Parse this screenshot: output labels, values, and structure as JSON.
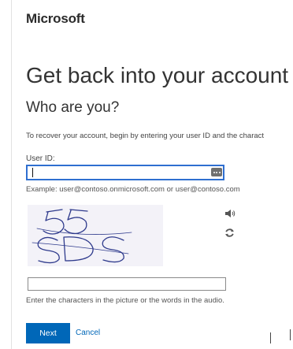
{
  "brand": {
    "name": "Microsoft"
  },
  "page": {
    "title": "Get back into your account",
    "subtitle": "Who are you?",
    "intro": "To recover your account, begin by entering your user ID and the charact"
  },
  "user_id": {
    "label": "User ID:",
    "value": "",
    "example": "Example: user@contoso.onmicrosoft.com or user@contoso.com"
  },
  "captcha": {
    "image_text": "55SDS",
    "audio_icon": "speaker-icon",
    "refresh_icon": "refresh-icon",
    "input_value": "",
    "hint": "Enter the characters in the picture or the words in the audio."
  },
  "actions": {
    "next_label": "Next",
    "cancel_label": "Cancel"
  },
  "colors": {
    "accent": "#0067b8",
    "focus_border": "#2f6fd0",
    "captcha_ink": "#2e3a8c"
  }
}
